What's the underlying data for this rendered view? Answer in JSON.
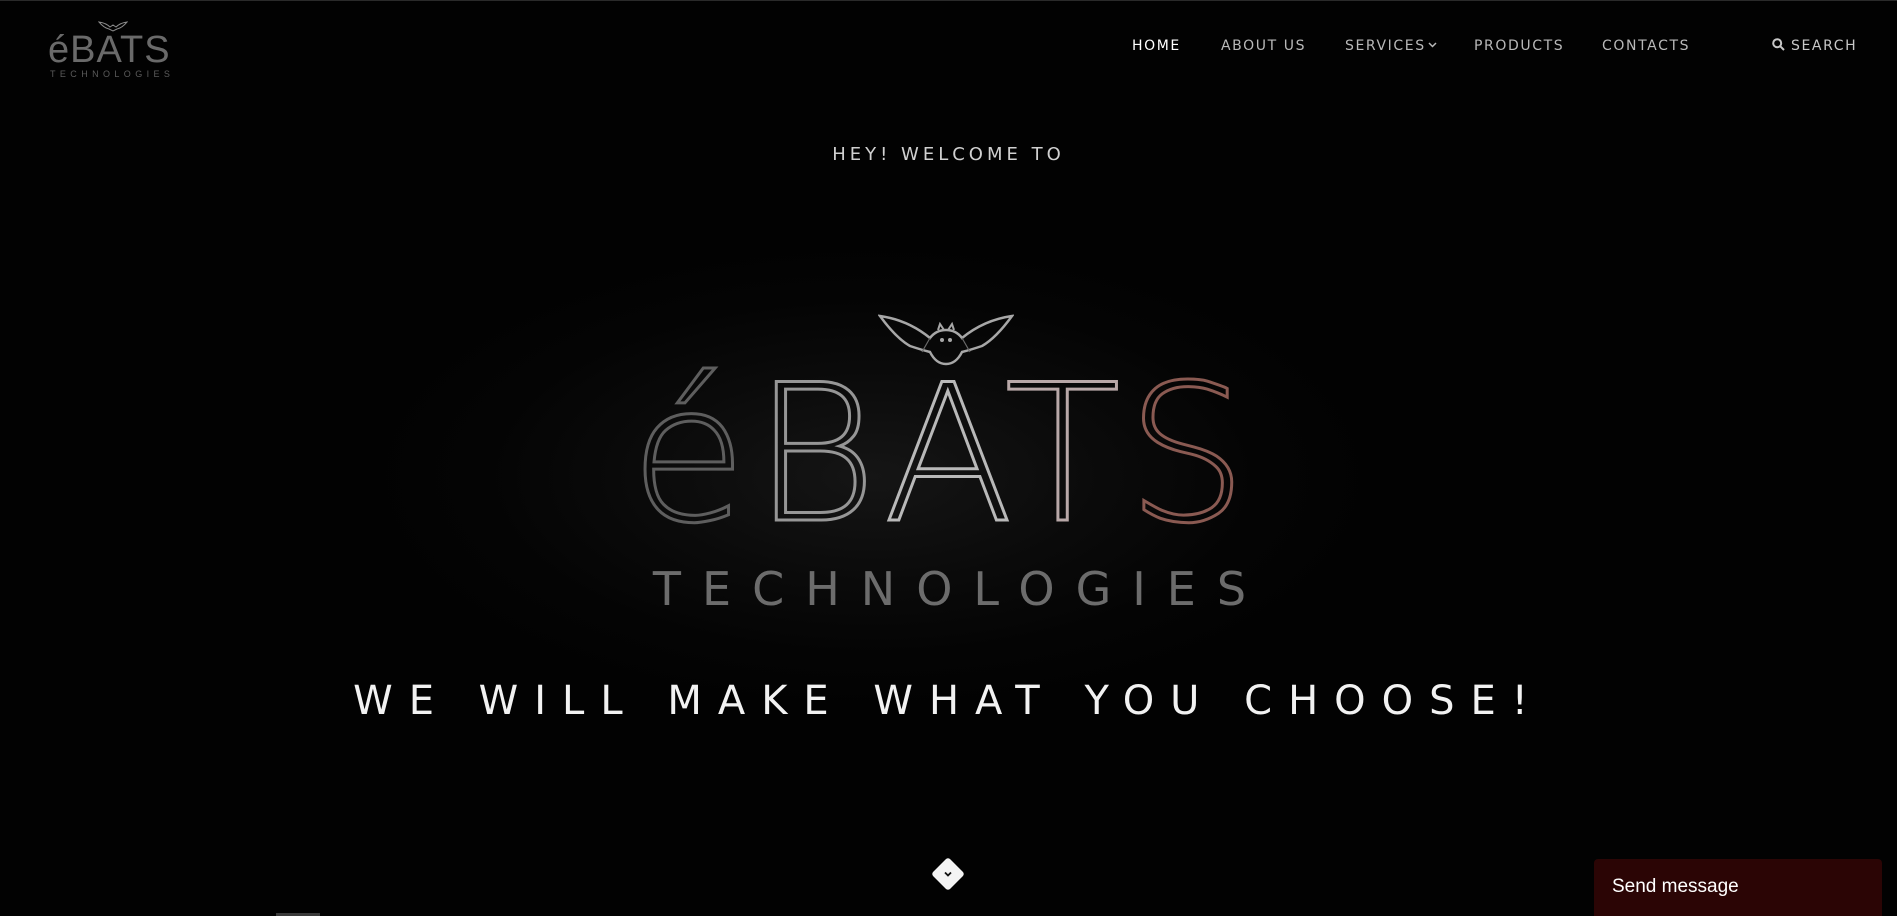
{
  "brand": {
    "logo_text": "éBATS",
    "logo_subtext": "TECHNOLOGIES"
  },
  "nav": {
    "items": [
      {
        "label": "HOME",
        "active": true
      },
      {
        "label": "ABOUT US",
        "active": false
      },
      {
        "label": "SERVICES",
        "active": false,
        "has_dropdown": true
      },
      {
        "label": "PRODUCTS",
        "active": false
      },
      {
        "label": "CONTACTS",
        "active": false
      }
    ],
    "search_label": "SEARCH",
    "search_icon": "search-icon"
  },
  "hero": {
    "welcome": "HEY! WELCOME TO",
    "brand_letters": [
      "é",
      "B",
      "A",
      "T",
      "S"
    ],
    "brand_subtext": "TECHNOLOGIES",
    "tagline": "WE WILL MAKE WHAT YOU CHOOSE!",
    "scroll_icon": "chevron-down-icon"
  },
  "chat": {
    "label": "Send message"
  },
  "colors": {
    "background": "#000000",
    "nav_text": "#b9b9b9",
    "nav_active": "#ffffff",
    "accent_letter": "#8a5a52",
    "chat_bg": "#2b0505"
  }
}
